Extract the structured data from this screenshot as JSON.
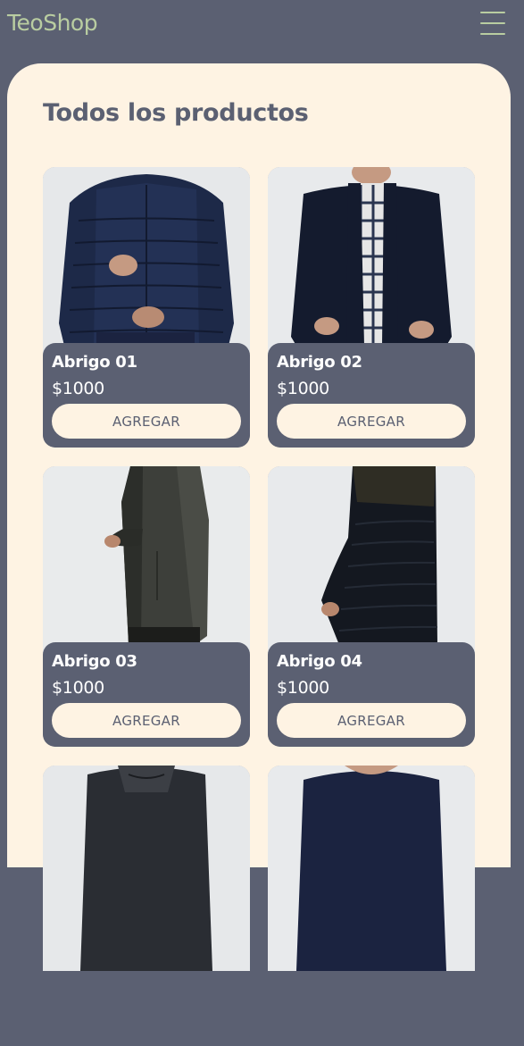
{
  "header": {
    "brand": "TeoShop",
    "menu_icon": "hamburger-menu-icon"
  },
  "main": {
    "title": "Todos los productos"
  },
  "products": [
    {
      "name": "Abrigo 01",
      "price": "$1000",
      "button": "AGREGAR"
    },
    {
      "name": "Abrigo 02",
      "price": "$1000",
      "button": "AGREGAR"
    },
    {
      "name": "Abrigo 03",
      "price": "$1000",
      "button": "AGREGAR"
    },
    {
      "name": "Abrigo 04",
      "price": "$1000",
      "button": "AGREGAR"
    },
    {
      "name": "",
      "price": "",
      "button": ""
    },
    {
      "name": "",
      "price": "",
      "button": ""
    }
  ],
  "colors": {
    "background": "#5b6072",
    "panel": "#fef3e3",
    "brand_text": "#b9cda1",
    "card": "#5b6072"
  }
}
